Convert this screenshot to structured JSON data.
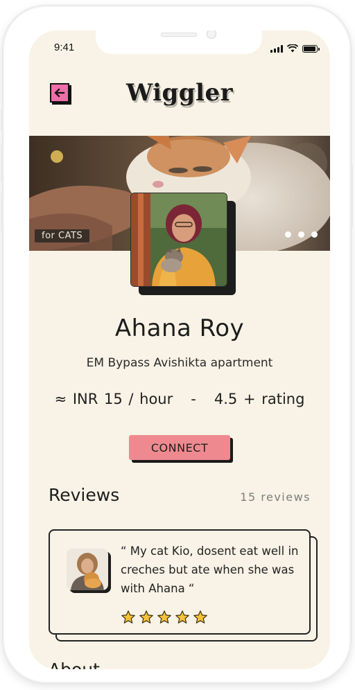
{
  "status_bar": {
    "time": "9:41"
  },
  "header": {
    "title": "Wiggler",
    "back_icon": "back-arrow-icon"
  },
  "hero": {
    "badge": "for CATS",
    "more_icon": "more-dots-icon"
  },
  "profile": {
    "name": "Ahana Roy",
    "address": "EM Bypass Avishikta apartment",
    "price_rating": "≈ INR 15 / hour   -   4.5 + rating"
  },
  "actions": {
    "connect_label": "CONNECT"
  },
  "reviews": {
    "title": "Reviews",
    "count": "15 reviews",
    "items": [
      {
        "text": "“ My cat Kio, dosent eat well in creches but ate when she was with Ahana “",
        "stars": 5
      }
    ]
  },
  "about": {
    "title": "About"
  },
  "colors": {
    "background": "#f8f3e6",
    "accent_pink": "#ee6fa8",
    "connect_button": "#ee8a8f",
    "star": "#f5c23a"
  }
}
